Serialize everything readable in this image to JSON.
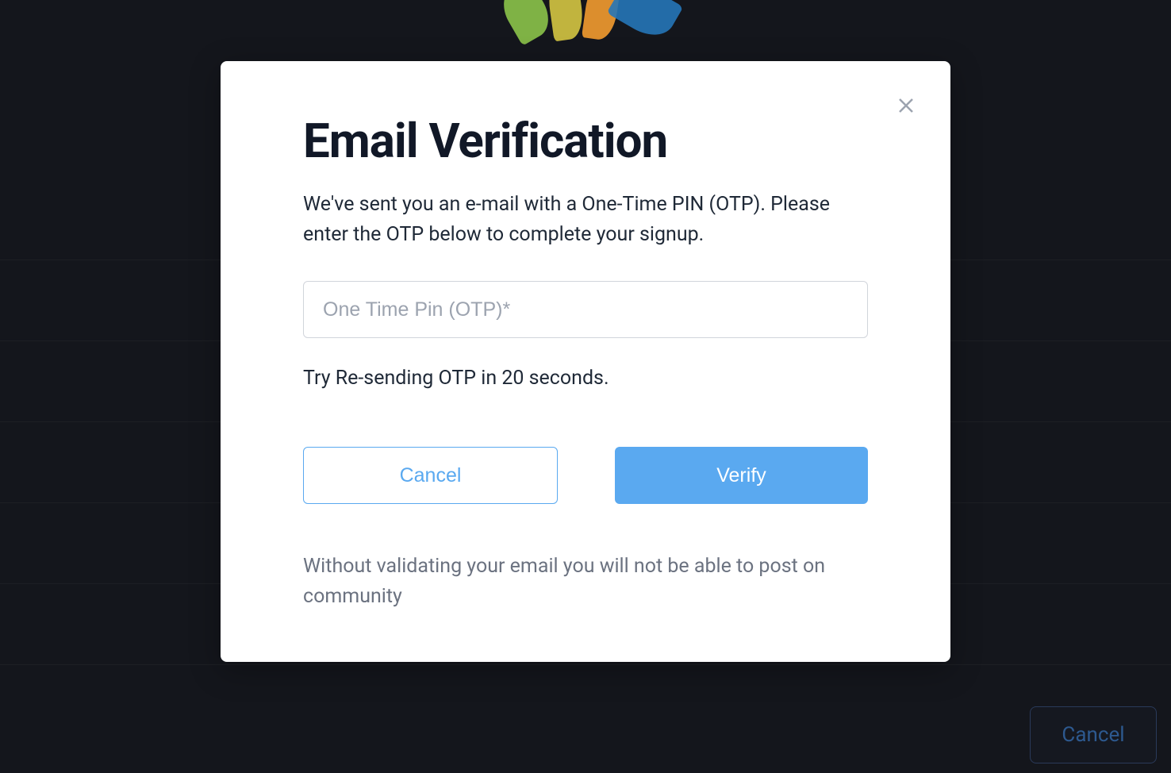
{
  "modal": {
    "title": "Email Verification",
    "description": "We've sent you an e-mail with a One-Time PIN (OTP). Please enter the OTP below to complete your signup.",
    "otp_placeholder": "One Time Pin (OTP)*",
    "otp_value": "",
    "resend_text": "Try Re-sending OTP in 20 seconds.",
    "cancel_label": "Cancel",
    "verify_label": "Verify",
    "footer_note": "Without validating your email you will not be able to post on community"
  },
  "background": {
    "cancel_label": "Cancel"
  }
}
